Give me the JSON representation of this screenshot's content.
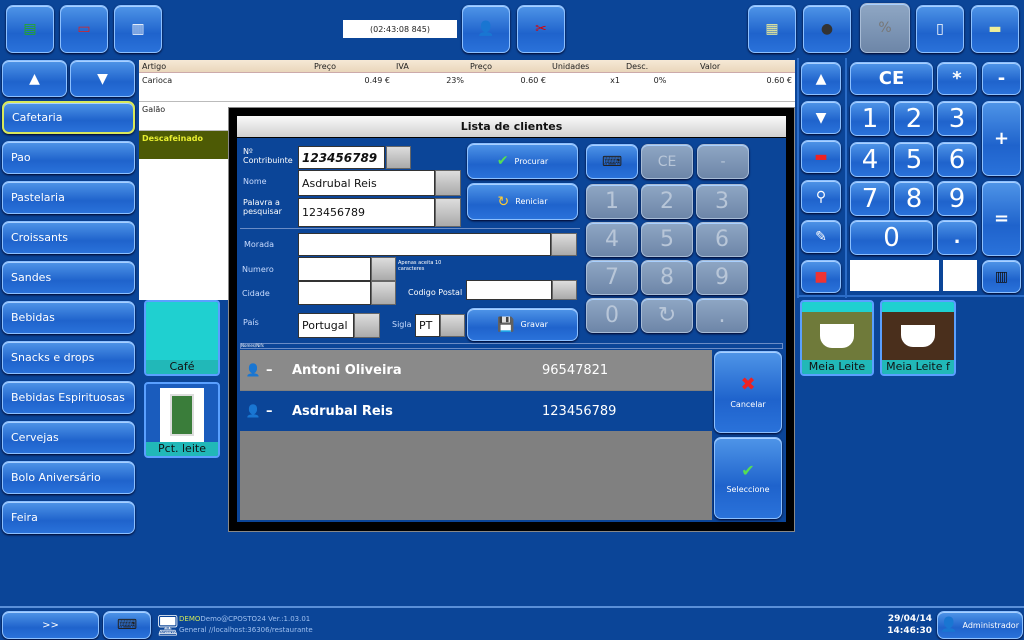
{
  "toolbar": {
    "timer": "(02:43:08 845)",
    "left_buttons": [
      "new-document-icon",
      "delete-document-icon",
      "split-document-icon"
    ],
    "mid_buttons": [
      "client-icon",
      "scissors-icon"
    ],
    "right_buttons": [
      "money-icon",
      "cash-drawer-icon",
      "percent-icon",
      "document-icon",
      "report-icon"
    ]
  },
  "categories": [
    "Cafetaria",
    "Pao",
    "Pastelaria",
    "Croissants",
    "Sandes",
    "Bebidas",
    "Snacks e drops",
    "Bebidas Espirituosas",
    "Cervejas",
    "Bolo Aniversário",
    "Feira"
  ],
  "order": {
    "columns": [
      "Artigo",
      "Preço",
      "IVA",
      "Preço",
      "Unidades",
      "Desc.",
      "Valor"
    ],
    "rows": [
      {
        "artigo": "Carioca",
        "preco": "0.49 €",
        "iva": "23%",
        "preco2": "0.60 €",
        "unidades": "x1",
        "desc": "0%",
        "valor": "0.60 €"
      },
      {
        "artigo": "Galão"
      }
    ],
    "highlight": "Descafeinado"
  },
  "products": [
    "Café",
    "Pct. leite"
  ],
  "right_products": [
    "Meia Leite",
    "Meia Leite f"
  ],
  "keypad": {
    "keys": [
      "CE",
      "*",
      "-",
      "1",
      "2",
      "3",
      "+",
      "4",
      "5",
      "6",
      "7",
      "8",
      "9",
      "=",
      "0",
      "."
    ]
  },
  "modal": {
    "title": "Lista de clientes",
    "labels": {
      "nif": "Nº Contribuinte",
      "nome": "Nome",
      "palavra": "Palavra a pesquisar",
      "morada": "Morada",
      "numero": "Numero",
      "cidade": "Cidade",
      "codigo_postal": "Codigo Postal",
      "pais": "País",
      "sigla": "Sigla",
      "hint": "Apenas aceita 10 caracteres",
      "list_header": "Nomes/Nifs"
    },
    "values": {
      "nif": "123456789",
      "nome": "Asdrubal Reis",
      "palavra": "123456789",
      "morada": "",
      "numero": "",
      "cidade": "",
      "codigo_postal": "",
      "pais": "Portugal",
      "sigla": "PT"
    },
    "buttons": {
      "procurar": "Procurar",
      "reiniciar": "Reniciar",
      "gravar": "Gravar",
      "cancelar": "Cancelar",
      "seleccione": "Seleccione"
    },
    "keypad": [
      "CE",
      "-",
      "1",
      "2",
      "3",
      "4",
      "5",
      "6",
      "7",
      "8",
      "9",
      "0",
      "↻",
      "."
    ],
    "clients": [
      {
        "name": "Antoni Oliveira",
        "nif": "96547821"
      },
      {
        "name": "Asdrubal Reis",
        "nif": "123456789"
      }
    ],
    "selected_client": 1
  },
  "status": {
    "demo": "DEMO",
    "user_version": "Demo@CPOSTO24 Ver.:1.03.01",
    "connection": "General //localhost:36306/restaurante",
    "date": "29/04/14",
    "time": "14:46:30",
    "user": "Administrador",
    "next": ">>"
  }
}
